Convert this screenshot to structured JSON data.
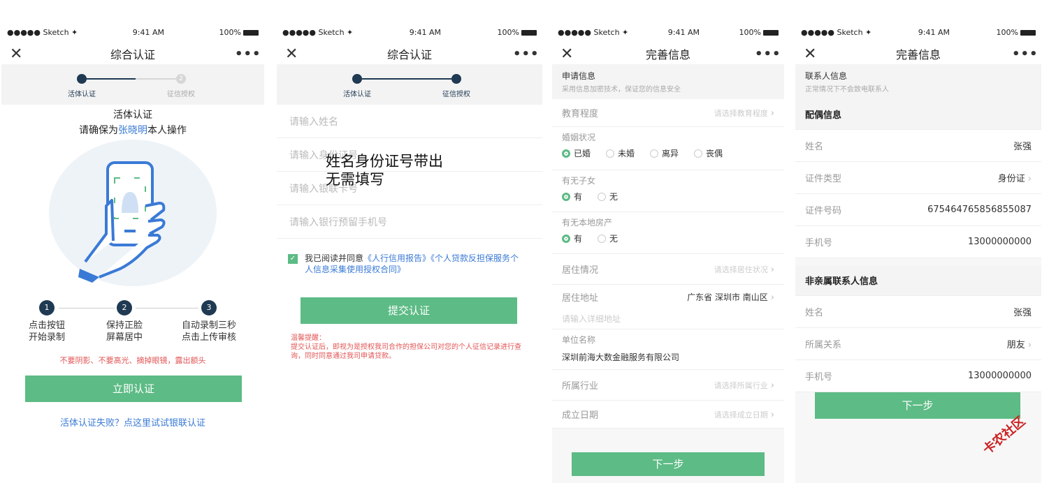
{
  "status": {
    "carrier": "●●●●● Sketch ✦",
    "time": "9:41 AM",
    "battery": "100%"
  },
  "screen1": {
    "nav_title": "综合认证",
    "steps": [
      "活体认证",
      "征信授权"
    ],
    "step2_num": "2",
    "heading": "活体认证",
    "sub_prefix": "请确保为",
    "sub_name": "张晓明",
    "sub_suffix": "本人操作",
    "instructions": [
      {
        "num": "1",
        "line1": "点击按钮",
        "line2": "开始录制"
      },
      {
        "num": "2",
        "line1": "保持正脸",
        "line2": "屏幕居中"
      },
      {
        "num": "3",
        "line1": "自动录制三秒",
        "line2": "点击上传审核"
      }
    ],
    "warning": "不要阴影、不要高光、摘掉眼镜，露出额头",
    "button": "立即认证",
    "link": "活体认证失败？点这里试试银联认证"
  },
  "screen2": {
    "nav_title": "综合认证",
    "steps": [
      "活体认证",
      "征信授权"
    ],
    "fields": [
      "请输入姓名",
      "请输入身份证号",
      "请输入银联卡号",
      "请输入银行预留手机号"
    ],
    "overlay_line1": "姓名身份证号带出",
    "overlay_line2": "无需填写",
    "agree_prefix": "我已阅读并同意",
    "agree_link": "《人行信用报告》《个人贷款反担保服务个人信息采集使用授权合同》",
    "button": "提交认证",
    "tip_title": "温馨提醒：",
    "tip_body": "提交认证后，即视为是授权我司合作的担保公司对您的个人征信记录进行查询，同时同意通过我司申请贷款。"
  },
  "screen3": {
    "nav_title": "完善信息",
    "section_title": "申请信息",
    "section_sub": "采用信息加密技术，保证您的信息安全",
    "education_label": "教育程度",
    "education_ph": "请选择教育程度",
    "marital_label": "婚姻状况",
    "marital_options": [
      "已婚",
      "未婚",
      "离异",
      "丧偶"
    ],
    "children_label": "有无子女",
    "property_label": "有无本地房产",
    "yes": "有",
    "no": "无",
    "residence_label": "居住情况",
    "residence_ph": "请选择居住状况",
    "address_label": "居住地址",
    "address_value": "广东省  深圳市  南山区",
    "address_detail_ph": "请输入详细地址",
    "company_label": "单位名称",
    "company_value": "深圳前海大数金融服务有限公司",
    "industry_label": "所属行业",
    "industry_ph": "请选择所属行业",
    "founded_label": "成立日期",
    "founded_ph": "请选择成立日期",
    "button": "下一步"
  },
  "screen4": {
    "nav_title": "完善信息",
    "section_title": "联系人信息",
    "section_sub": "正常情况下不会致电联系人",
    "spouse_title": "配偶信息",
    "spouse": [
      {
        "k": "姓名",
        "v": "张强",
        "chev": ""
      },
      {
        "k": "证件类型",
        "v": "身份证",
        "chev": "›"
      },
      {
        "k": "证件号码",
        "v": "675464765856855087",
        "chev": ""
      },
      {
        "k": "手机号",
        "v": "13000000000",
        "chev": ""
      }
    ],
    "other_title": "非亲属联系人信息",
    "other": [
      {
        "k": "姓名",
        "v": "张强",
        "chev": ""
      },
      {
        "k": "所属关系",
        "v": "朋友",
        "chev": "›"
      },
      {
        "k": "手机号",
        "v": "13000000000",
        "chev": ""
      }
    ],
    "button": "下一步"
  },
  "watermark": "卡农社区",
  "colors": {
    "accent": "#5dbb85",
    "link": "#3a7ad6",
    "warn": "#e25555",
    "step": "#1f3a52"
  }
}
